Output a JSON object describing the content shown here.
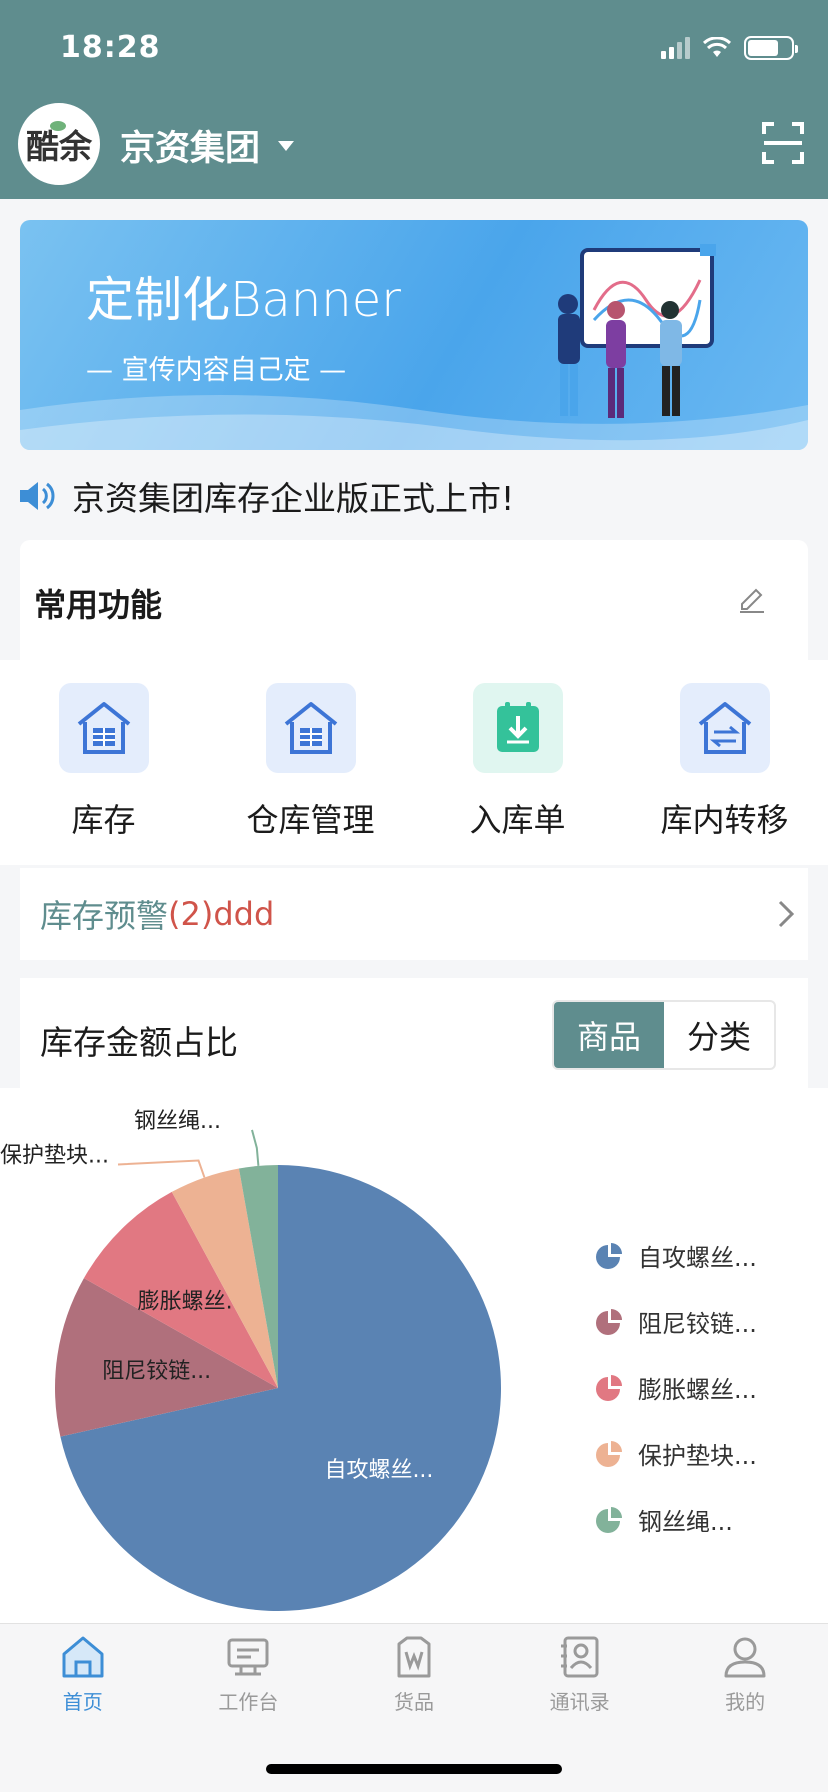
{
  "status": {
    "time": "18:28"
  },
  "header": {
    "logo_text": "酷余",
    "company": "京资集团"
  },
  "banner": {
    "title": "定制化Banner",
    "subtitle": "— 宣传内容自己定 —"
  },
  "notice": {
    "text": "京资集团库存企业版正式上市!"
  },
  "common": {
    "title": "常用功能",
    "items": [
      {
        "label": "库存",
        "icon": "house-grid-icon"
      },
      {
        "label": "仓库管理",
        "icon": "house-grid-icon"
      },
      {
        "label": "入库单",
        "icon": "inbound-icon"
      },
      {
        "label": "库内转移",
        "icon": "transfer-icon"
      }
    ]
  },
  "warning": {
    "label": "库存预警",
    "count": "(2)ddd"
  },
  "chart_section": {
    "title": "库存金额占比",
    "tabs": [
      "商品",
      "分类"
    ],
    "active_tab": "商品"
  },
  "chart_data": {
    "type": "pie",
    "categories": [
      "自攻螺丝...",
      "阻尼铰链...",
      "膨胀螺丝...",
      "保护垫块...",
      "钢丝绳..."
    ],
    "values": [
      71.5,
      11.7,
      8.9,
      5.1,
      2.8
    ],
    "colors": [
      "#5a83b3",
      "#b0707c",
      "#e17882",
      "#edb293",
      "#82b29a"
    ],
    "legend_position": "right"
  },
  "tabbar": {
    "items": [
      {
        "label": "首页",
        "icon": "home-icon",
        "active": true
      },
      {
        "label": "工作台",
        "icon": "desk-icon",
        "active": false
      },
      {
        "label": "货品",
        "icon": "goods-icon",
        "active": false
      },
      {
        "label": "通讯录",
        "icon": "contacts-icon",
        "active": false
      },
      {
        "label": "我的",
        "icon": "user-icon",
        "active": false
      }
    ]
  }
}
